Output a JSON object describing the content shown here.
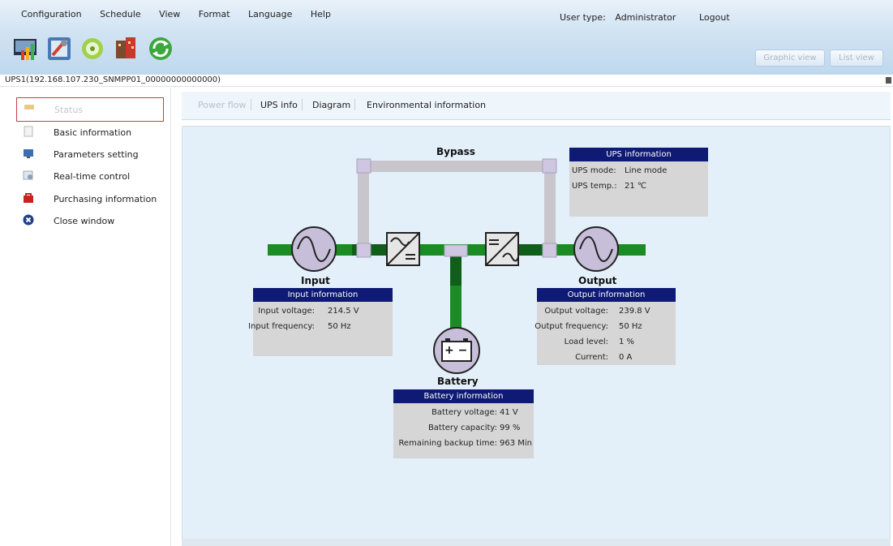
{
  "menu": [
    "Configuration",
    "Schedule",
    "View",
    "Format",
    "Language",
    "Help"
  ],
  "user": {
    "label": "User type:",
    "value": "Administrator",
    "logout": "Logout"
  },
  "toolbar_icons": [
    "monitor-chart-icon",
    "settings-tools-icon",
    "disc-icon",
    "building-icon",
    "refresh-icon"
  ],
  "view_buttons": {
    "graphic": "Graphic view",
    "list": "List view"
  },
  "ups_name": "UPS1(192.168.107.230_SNMPP01_00000000000000)",
  "sidebar": [
    {
      "label": "Status",
      "icon": "status-icon"
    },
    {
      "label": "Basic information",
      "icon": "document-icon"
    },
    {
      "label": "Parameters setting",
      "icon": "monitor-icon"
    },
    {
      "label": "Real-time control",
      "icon": "control-icon"
    },
    {
      "label": "Purchasing information",
      "icon": "shopping-icon"
    },
    {
      "label": "Close window",
      "icon": "close-icon"
    }
  ],
  "tabs": [
    "Power flow",
    "UPS info",
    "Diagram",
    "Environmental information"
  ],
  "diagram": {
    "bypass": "Bypass",
    "input": "Input",
    "output": "Output",
    "battery": "Battery",
    "ups_info": {
      "title": "UPS information",
      "mode_label": "UPS mode:",
      "mode_value": "Line mode",
      "temp_label": "UPS temp.:",
      "temp_value": "21 ℃"
    },
    "input_info": {
      "title": "Input information",
      "voltage_label": "Input voltage:",
      "voltage_value": "214.5 V",
      "freq_label": "Input frequency:",
      "freq_value": "50 Hz"
    },
    "output_info": {
      "title": "Output information",
      "voltage_label": "Output voltage:",
      "voltage_value": "239.8 V",
      "freq_label": "Output frequency:",
      "freq_value": "50 Hz",
      "load_label": "Load level:",
      "load_value": "1 %",
      "current_label": "Current:",
      "current_value": "0 A"
    },
    "battery_info": {
      "title": "Battery information",
      "voltage_label": "Battery voltage:",
      "voltage_value": "41 V",
      "capacity_label": "Battery capacity:",
      "capacity_value": "99 %",
      "backup_label": "Remaining backup time:",
      "backup_value": "963 Min"
    },
    "battery_symbol": "+ −"
  },
  "colors": {
    "bus_green": "#1a8c23",
    "bypass_gray": "#c9c5cc",
    "header_navy": "#0e1a73",
    "circle_fill": "#c7bfd9"
  }
}
